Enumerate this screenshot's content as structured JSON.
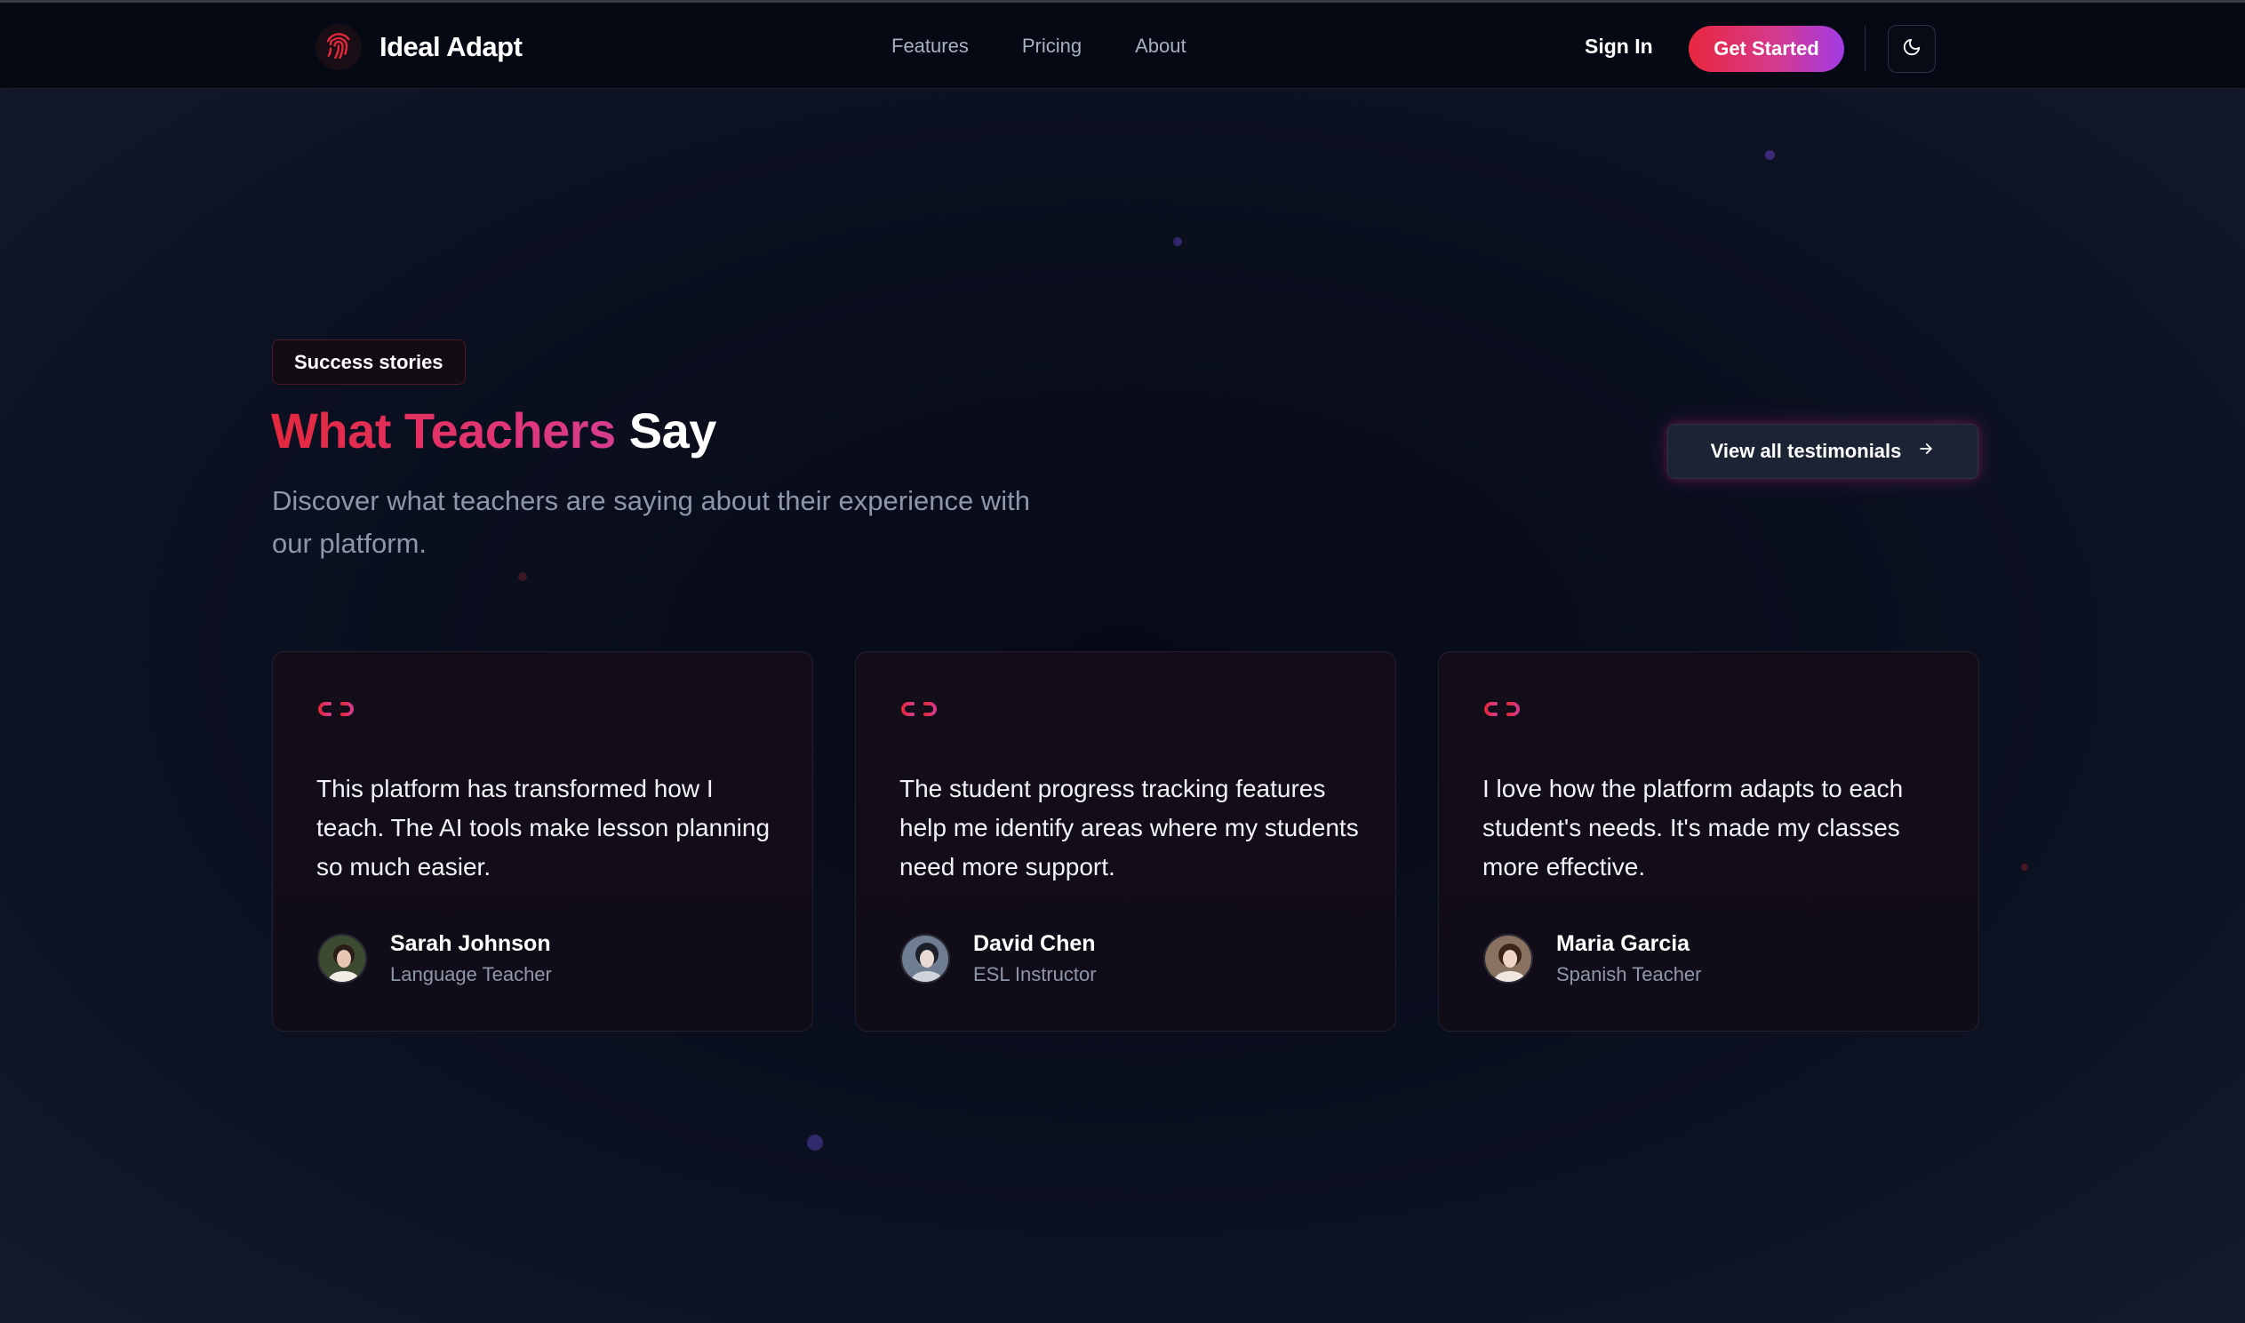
{
  "nav": {
    "brand": "Ideal Adapt",
    "brand_icon": "fingerprint-icon",
    "links": [
      "Features",
      "Pricing",
      "About"
    ],
    "sign_in": "Sign In",
    "get_started": "Get Started",
    "theme_icon": "moon-icon"
  },
  "hero": {
    "badge": "Success stories",
    "title_highlight": "What Teachers",
    "title_rest": "Say",
    "subtitle": "Discover what teachers are saying about their experience with our platform.",
    "view_all": "View all testimonials"
  },
  "testimonials": [
    {
      "text": "This platform has transformed how I teach. The AI tools make lesson planning so much easier.",
      "name": "Sarah Johnson",
      "role": "Language Teacher"
    },
    {
      "text": "The student progress tracking features help me identify areas where my students need more support.",
      "name": "David Chen",
      "role": "ESL Instructor"
    },
    {
      "text": "I love how the platform adapts to each student's needs. It's made my classes more effective.",
      "name": "Maria Garcia",
      "role": "Spanish Teacher"
    }
  ],
  "colors": {
    "accent_red": "#e4283c",
    "accent_pink": "#d63a8c",
    "accent_purple": "#a23be6",
    "background": "#0a0e1a"
  }
}
